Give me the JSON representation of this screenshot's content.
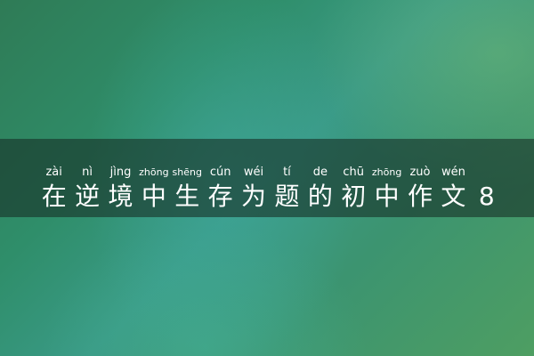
{
  "title": {
    "chars": [
      {
        "hanzi": "在",
        "pinyin": "zài"
      },
      {
        "hanzi": "逆",
        "pinyin": "nì"
      },
      {
        "hanzi": "境",
        "pinyin": "jìng"
      },
      {
        "hanzi": "中",
        "pinyin": "zhōng"
      },
      {
        "hanzi": "生",
        "pinyin": "shēng"
      },
      {
        "hanzi": "存",
        "pinyin": "cún"
      },
      {
        "hanzi": "为",
        "pinyin": "wéi"
      },
      {
        "hanzi": "题",
        "pinyin": "tí"
      },
      {
        "hanzi": "的",
        "pinyin": "de"
      },
      {
        "hanzi": "初",
        "pinyin": "chū"
      },
      {
        "hanzi": "中",
        "pinyin": "zhōng"
      },
      {
        "hanzi": "作",
        "pinyin": "zuò"
      },
      {
        "hanzi": "文",
        "pinyin": "wén"
      },
      {
        "hanzi": "8",
        "pinyin": ""
      }
    ]
  },
  "colors": {
    "text": "#ffffff",
    "banner": "#19322a"
  }
}
